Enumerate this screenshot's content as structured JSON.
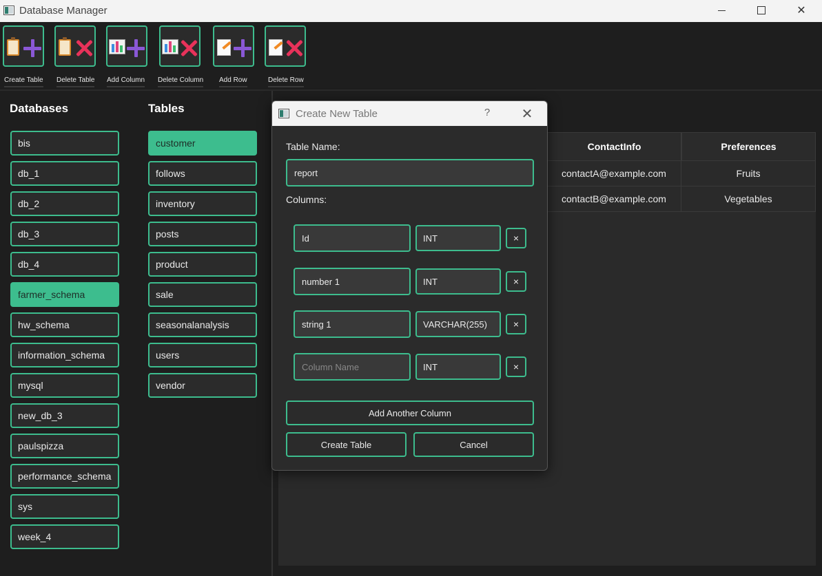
{
  "window": {
    "title": "Database Manager"
  },
  "toolbar": {
    "buttons": [
      {
        "label": "Create Table",
        "icon": "create-table-icon"
      },
      {
        "label": "Delete Table",
        "icon": "delete-table-icon"
      },
      {
        "label": "Add Column",
        "icon": "add-column-icon"
      },
      {
        "label": "Delete Column",
        "icon": "delete-column-icon"
      },
      {
        "label": "Add Row",
        "icon": "add-row-icon"
      },
      {
        "label": "Delete Row",
        "icon": "delete-row-icon"
      }
    ]
  },
  "databases": {
    "heading": "Databases",
    "items": [
      "bis",
      "db_1",
      "db_2",
      "db_3",
      "db_4",
      "farmer_schema",
      "hw_schema",
      "information_schema",
      "mysql",
      "new_db_3",
      "paulspizza",
      "performance_schema",
      "sys",
      "week_4"
    ],
    "selected": "farmer_schema"
  },
  "tables": {
    "heading": "Tables",
    "items": [
      "customer",
      "follows",
      "inventory",
      "posts",
      "product",
      "sale",
      "seasonalanalysis",
      "users",
      "vendor"
    ],
    "selected": "customer"
  },
  "grid": {
    "columns": [
      "ContactInfo",
      "Preferences"
    ],
    "rows": [
      [
        "contactA@example.com",
        "Fruits"
      ],
      [
        "contactB@example.com",
        "Vegetables"
      ]
    ]
  },
  "dialog": {
    "title": "Create New Table",
    "help": "?",
    "close": "✕",
    "table_name_label": "Table Name:",
    "table_name_value": "report",
    "columns_label": "Columns:",
    "columns": [
      {
        "name": "Id",
        "type": "INT"
      },
      {
        "name": "number 1",
        "type": "INT"
      },
      {
        "name": "string 1",
        "type": "VARCHAR(255)"
      },
      {
        "name": "",
        "type": "INT"
      }
    ],
    "column_name_placeholder": "Column Name",
    "remove_label": "×",
    "add_column_label": "Add Another Column",
    "create_label": "Create Table",
    "cancel_label": "Cancel"
  },
  "colors": {
    "accent": "#3dbd8e",
    "background": "#1e1e1e",
    "panel": "#2b2b2b"
  }
}
